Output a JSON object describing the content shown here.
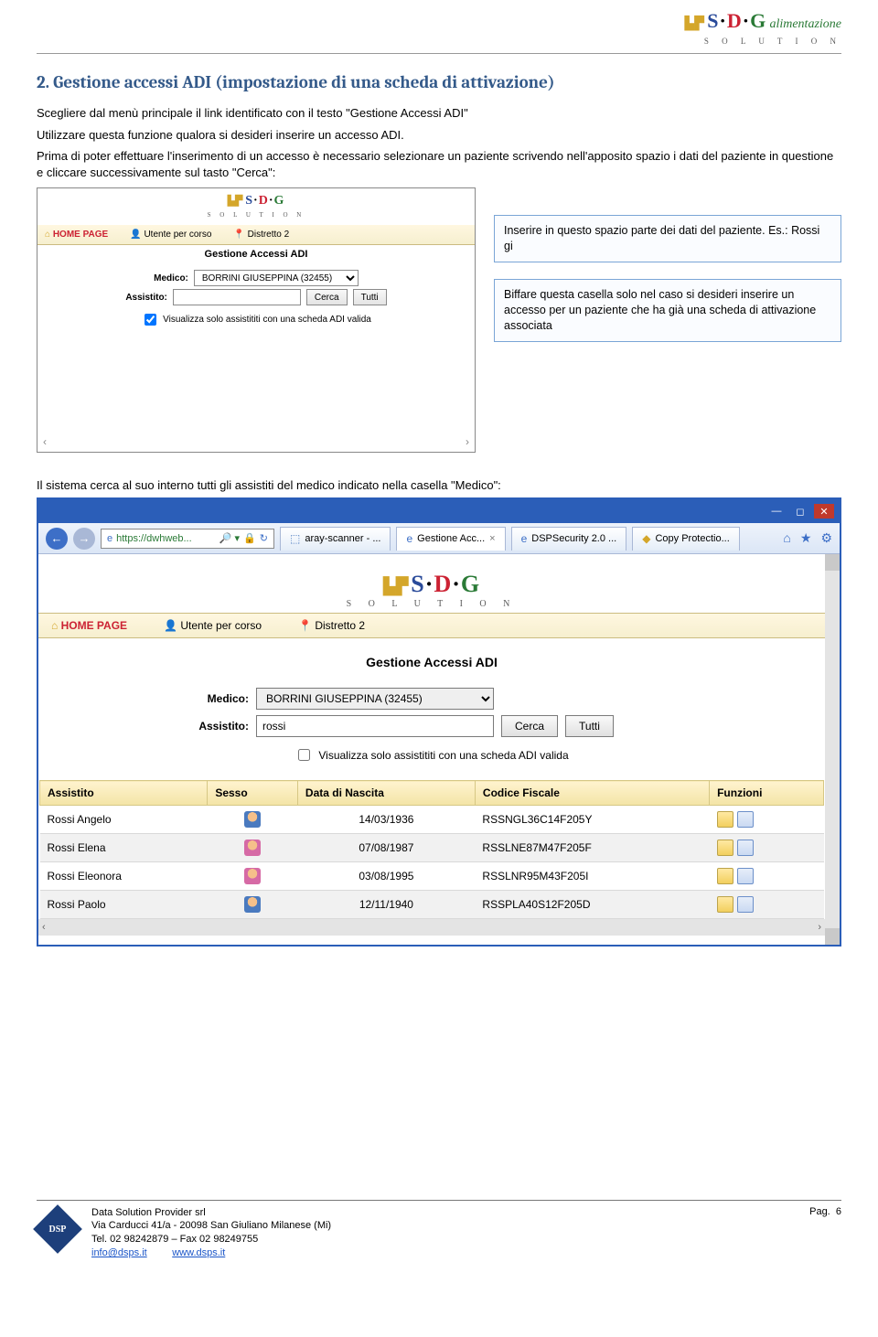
{
  "header_logo": {
    "brand": "S·D·G",
    "sub": "S O L U T I O N",
    "alim": "alimentazione"
  },
  "section_title": "2. Gestione accessi ADI (impostazione di una scheda di attivazione)",
  "para1": "Scegliere dal menù principale il link identificato con il testo \"Gestione Accessi ADI\"",
  "para2": "Utilizzare questa funzione qualora si desideri inserire un accesso ADI.",
  "para3": "Prima di poter effettuare l'inserimento di un accesso è necessario selezionare un paziente scrivendo nell'apposito spazio i dati del paziente in questione e cliccare successivamente sul tasto \"Cerca\":",
  "mini": {
    "home": "HOME PAGE",
    "user_item": "Utente per corso",
    "dist_item": "Distretto 2",
    "title": "Gestione Accessi ADI",
    "medico_label": "Medico:",
    "medico_value": "BORRINI GIUSEPPINA (32455)",
    "assistito_label": "Assistito:",
    "assistito_value": "",
    "cerca": "Cerca",
    "tutti": "Tutti",
    "chk_label": "Visualizza solo assistititi con una scheda ADI valida"
  },
  "callout1": "Inserire in questo spazio parte dei dati del paziente. Es.: Rossi gi",
  "callout2": "Biffare questa casella solo nel caso si desideri inserire un accesso per un paziente che ha già una scheda di attivazione associata",
  "caption2": "Il sistema cerca al suo interno tutti gli assistiti del medico indicato nella casella \"Medico\":",
  "browser": {
    "url": "https://dwhweb...",
    "tab1": "aray-scanner - ...",
    "tab2": "Gestione Acc...",
    "tab3": "DSPSecurity 2.0 ...",
    "tab4": "Copy Protectio...",
    "home": "HOME PAGE",
    "user_item": "Utente per corso",
    "dist_item": "Distretto 2",
    "title": "Gestione Accessi ADI",
    "medico_label": "Medico:",
    "medico_value": "BORRINI GIUSEPPINA (32455)",
    "assistito_label": "Assistito:",
    "assistito_value": "rossi",
    "cerca": "Cerca",
    "tutti": "Tutti",
    "chk_label": "Visualizza solo assistititi con una scheda ADI valida",
    "cols": {
      "c1": "Assistito",
      "c2": "Sesso",
      "c3": "Data di Nascita",
      "c4": "Codice Fiscale",
      "c5": "Funzioni"
    },
    "rows": [
      {
        "name": "Rossi Angelo",
        "sex": "m",
        "dob": "14/03/1936",
        "cf": "RSSNGL36C14F205Y"
      },
      {
        "name": "Rossi Elena",
        "sex": "f",
        "dob": "07/08/1987",
        "cf": "RSSLNE87M47F205F"
      },
      {
        "name": "Rossi Eleonora",
        "sex": "f",
        "dob": "03/08/1995",
        "cf": "RSSLNR95M43F205I"
      },
      {
        "name": "Rossi Paolo",
        "sex": "m",
        "dob": "12/11/1940",
        "cf": "RSSPLA40S12F205D"
      }
    ]
  },
  "footer": {
    "company": "Data Solution Provider srl",
    "addr": "Via Carducci 41/a - 20098 San Giuliano Milanese (Mi)",
    "tel": "Tel. 02 98242879 – Fax 02 98249755",
    "mail": "info@dsps.it",
    "site": "www.dsps.it",
    "pag_label": "Pag.",
    "pag_num": "6"
  }
}
